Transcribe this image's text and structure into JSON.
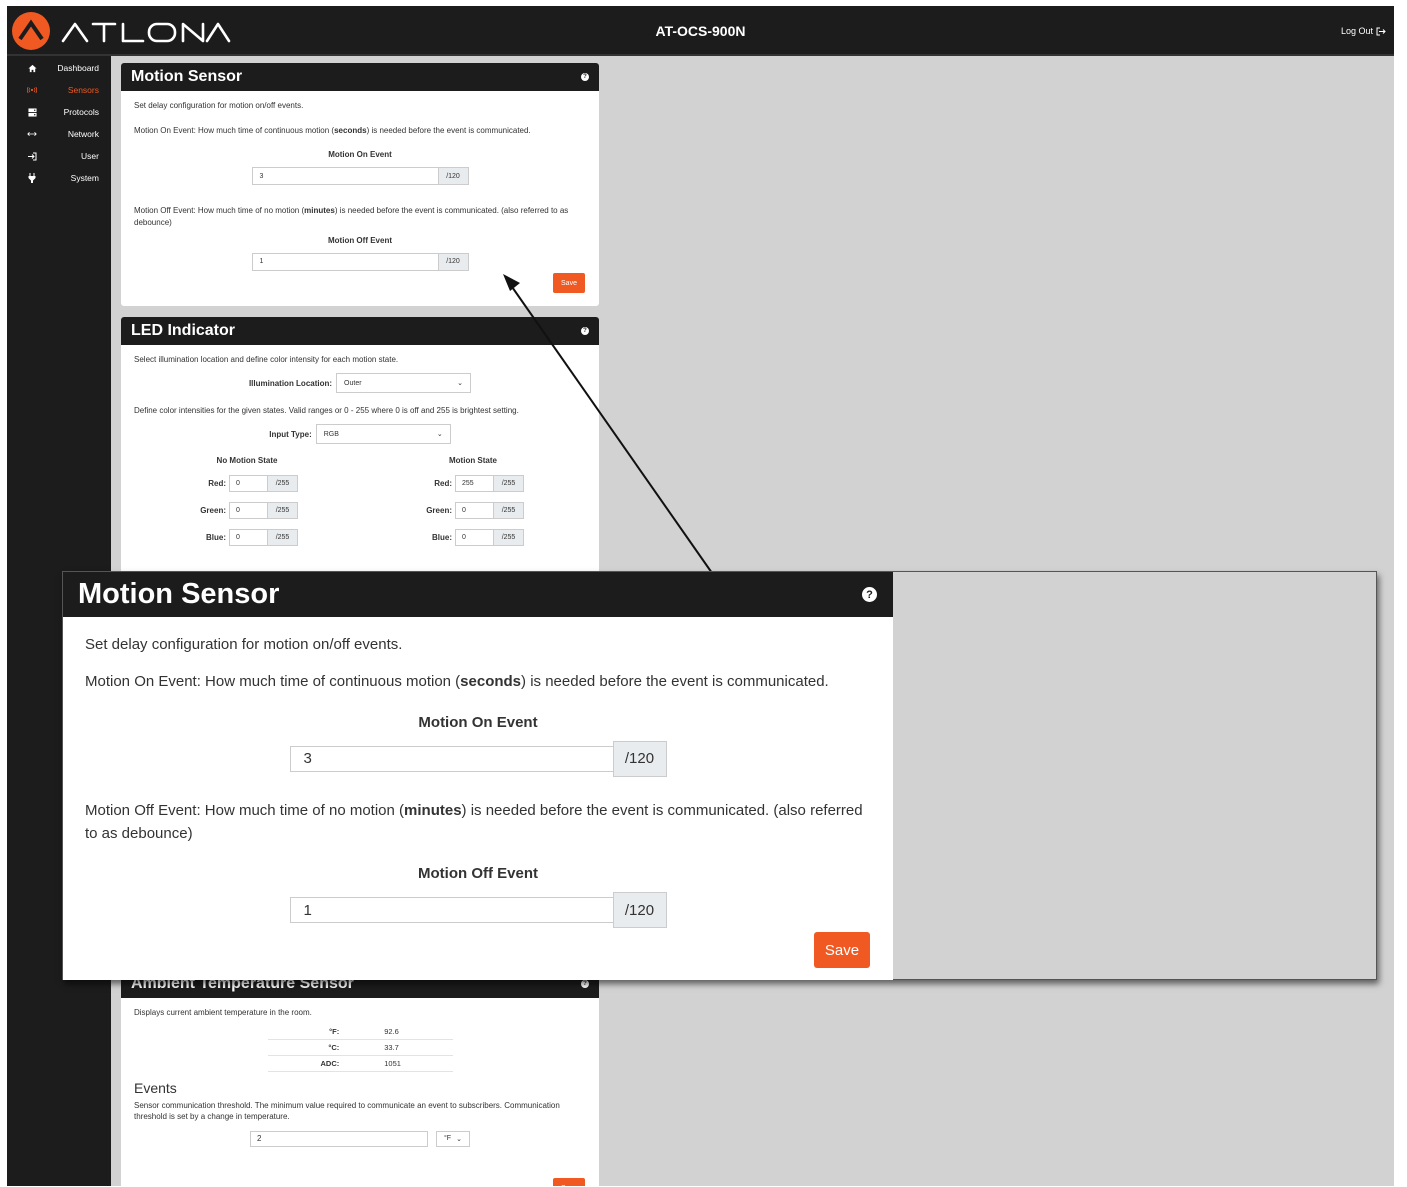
{
  "header": {
    "brand": "ATLONA",
    "device_name": "AT-OCS-900N",
    "logout_label": "Log Out"
  },
  "sidebar": {
    "items": [
      {
        "label": "Dashboard",
        "icon": "home-icon"
      },
      {
        "label": "Sensors",
        "icon": "broadcast-icon",
        "active": true
      },
      {
        "label": "Protocols",
        "icon": "server-icon"
      },
      {
        "label": "Network",
        "icon": "arrows-icon"
      },
      {
        "label": "User",
        "icon": "login-icon"
      },
      {
        "label": "System",
        "icon": "plug-icon"
      }
    ]
  },
  "motion_sensor": {
    "title": "Motion Sensor",
    "description": "Set delay configuration for motion on/off events.",
    "on_desc_pre": "Motion On Event: How much time of continuous motion (",
    "on_desc_bold": "seconds",
    "on_desc_post": ") is needed before the event is communicated.",
    "on_label": "Motion On Event",
    "on_value": "3",
    "on_max": "/120",
    "off_desc_pre": "Motion Off Event: How much time of no motion (",
    "off_desc_bold": "minutes",
    "off_desc_post": ") is needed before the event is communicated. (also referred to as debounce)",
    "off_label": "Motion Off Event",
    "off_value": "1",
    "off_max": "/120",
    "save_label": "Save"
  },
  "led_indicator": {
    "title": "LED Indicator",
    "description": "Select illumination location and define color intensity for each motion state.",
    "location_label": "Illumination Location:",
    "location_value": "Outer",
    "intensity_desc": "Define color intensities for the given states. Valid ranges or 0 - 255 where 0 is off and 255 is brightest setting.",
    "input_type_label": "Input Type:",
    "input_type_value": "RGB",
    "no_motion_title": "No Motion State",
    "motion_title": "Motion State",
    "red_label": "Red:",
    "green_label": "Green:",
    "blue_label": "Blue:",
    "max": "/255",
    "no_motion": {
      "red": "0",
      "green": "0",
      "blue": "0"
    },
    "motion": {
      "red": "255",
      "green": "0",
      "blue": "0"
    }
  },
  "ambient": {
    "title": "Ambient Temperature Sensor",
    "description": "Displays current ambient temperature in the room.",
    "rows": [
      {
        "label": "°F:",
        "value": "92.6"
      },
      {
        "label": "°C:",
        "value": "33.7"
      },
      {
        "label": "ADC:",
        "value": "1051"
      }
    ],
    "events_title": "Events",
    "events_desc": "Sensor communication threshold. The minimum value required to communicate an event to subscribers. Communication threshold is set by a change in temperature.",
    "threshold_value": "2",
    "unit_value": "°F",
    "save_label": "Save"
  },
  "colors": {
    "accent": "#f05a22",
    "dark": "#1c1c1c",
    "background": "#d2d2d2"
  }
}
